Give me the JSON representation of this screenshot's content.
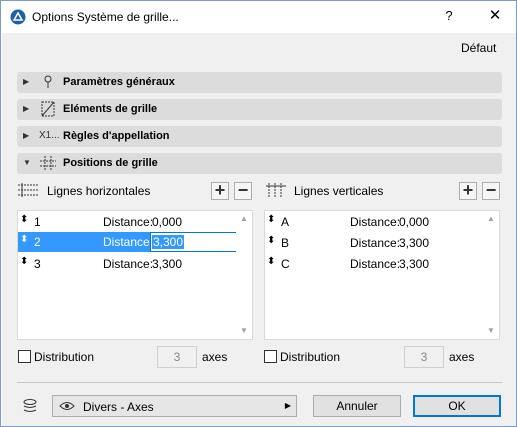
{
  "window": {
    "title": "Options Système de grille...",
    "help_label": "?",
    "close_label": "✕"
  },
  "default_link": "Défaut",
  "sections": [
    {
      "label": "Paramètres généraux",
      "icon": "pin-icon",
      "expanded": false
    },
    {
      "label": "Eléments de grille",
      "icon": "grid-element-icon",
      "expanded": false
    },
    {
      "label": "Règles d'appellation",
      "icon_text": "X1...",
      "icon": "naming-icon",
      "expanded": false
    },
    {
      "label": "Positions de grille",
      "icon": "grid-positions-icon",
      "expanded": true
    }
  ],
  "horizontal": {
    "title": "Lignes horizontales",
    "add_label": "+",
    "remove_label": "−",
    "rows": [
      {
        "name": "1",
        "distance_label": "Distance:",
        "value": "0,000"
      },
      {
        "name": "2",
        "distance_label": "Distance:",
        "value": "3,300",
        "selected": true
      },
      {
        "name": "3",
        "distance_label": "Distance:",
        "value": "3,300"
      }
    ],
    "distribution_label": "Distribution",
    "axes_count": "3",
    "axes_label": "axes"
  },
  "vertical": {
    "title": "Lignes verticales",
    "add_label": "+",
    "remove_label": "−",
    "rows": [
      {
        "name": "A",
        "distance_label": "Distance:",
        "value": "0,000"
      },
      {
        "name": "B",
        "distance_label": "Distance:",
        "value": "3,300"
      },
      {
        "name": "C",
        "distance_label": "Distance:",
        "value": "3,300"
      }
    ],
    "distribution_label": "Distribution",
    "axes_count": "3",
    "axes_label": "axes"
  },
  "footer": {
    "layer_dropdown": "Divers - Axes",
    "cancel_label": "Annuler",
    "ok_label": "OK"
  },
  "colors": {
    "selection": "#3399ff",
    "section_bg": "#dcdcdc",
    "accent": "#0078d7"
  }
}
